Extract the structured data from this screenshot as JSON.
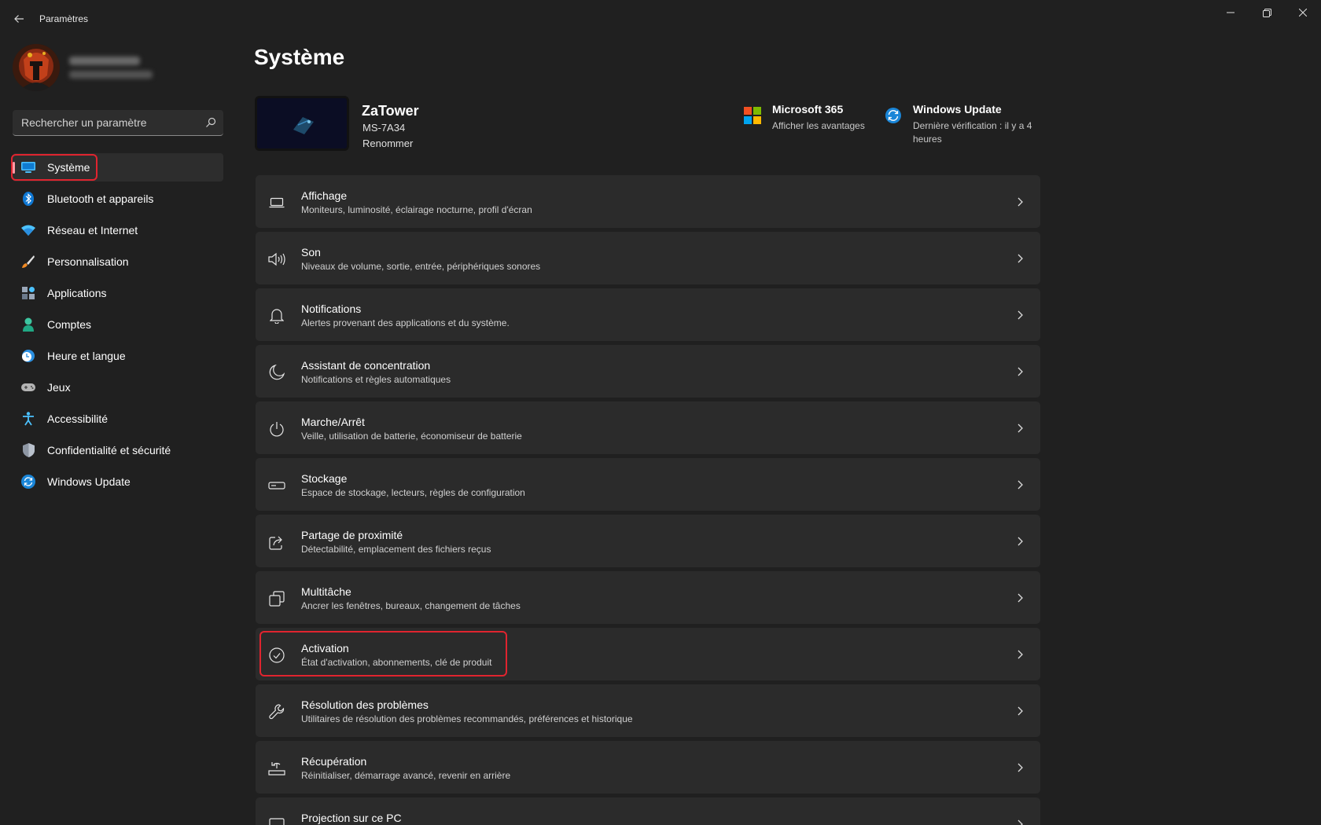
{
  "window": {
    "title": "Paramètres"
  },
  "sidebar": {
    "search_placeholder": "Rechercher un paramètre",
    "items": [
      {
        "label": "Système",
        "icon": "monitor-icon",
        "active": true
      },
      {
        "label": "Bluetooth et appareils",
        "icon": "bluetooth-icon"
      },
      {
        "label": "Réseau et Internet",
        "icon": "wifi-icon"
      },
      {
        "label": "Personnalisation",
        "icon": "brush-icon"
      },
      {
        "label": "Applications",
        "icon": "apps-icon"
      },
      {
        "label": "Comptes",
        "icon": "person-icon"
      },
      {
        "label": "Heure et langue",
        "icon": "clock-globe-icon"
      },
      {
        "label": "Jeux",
        "icon": "gamepad-icon"
      },
      {
        "label": "Accessibilité",
        "icon": "accessibility-icon"
      },
      {
        "label": "Confidentialité et sécurité",
        "icon": "shield-icon"
      },
      {
        "label": "Windows Update",
        "icon": "sync-icon"
      }
    ]
  },
  "main": {
    "title": "Système",
    "device": {
      "name": "ZaTower",
      "model": "MS-7A34",
      "rename": "Renommer"
    },
    "quick_links": [
      {
        "title": "Microsoft 365",
        "subtitle": "Afficher les avantages",
        "icon": "microsoft-logo-icon"
      },
      {
        "title": "Windows Update",
        "subtitle": "Dernière vérification : il y a 4 heures",
        "icon": "windows-update-icon"
      }
    ],
    "settings": [
      {
        "title": "Affichage",
        "subtitle": "Moniteurs, luminosité, éclairage nocturne, profil d'écran",
        "icon": "display-icon"
      },
      {
        "title": "Son",
        "subtitle": "Niveaux de volume, sortie, entrée, périphériques sonores",
        "icon": "speaker-icon"
      },
      {
        "title": "Notifications",
        "subtitle": "Alertes provenant des applications et du système.",
        "icon": "bell-icon"
      },
      {
        "title": "Assistant de concentration",
        "subtitle": "Notifications et règles automatiques",
        "icon": "moon-icon"
      },
      {
        "title": "Marche/Arrêt",
        "subtitle": "Veille, utilisation de batterie, économiseur de batterie",
        "icon": "power-icon"
      },
      {
        "title": "Stockage",
        "subtitle": "Espace de stockage, lecteurs, règles de configuration",
        "icon": "storage-icon"
      },
      {
        "title": "Partage de proximité",
        "subtitle": "Détectabilité, emplacement des fichiers reçus",
        "icon": "share-icon"
      },
      {
        "title": "Multitâche",
        "subtitle": "Ancrer les fenêtres, bureaux, changement de tâches",
        "icon": "multitask-icon"
      },
      {
        "title": "Activation",
        "subtitle": "État d'activation, abonnements, clé de produit",
        "icon": "check-circle-icon"
      },
      {
        "title": "Résolution des problèmes",
        "subtitle": "Utilitaires de résolution des problèmes recommandés, préférences et historique",
        "icon": "wrench-icon"
      },
      {
        "title": "Récupération",
        "subtitle": "Réinitialiser, démarrage avancé, revenir en arrière",
        "icon": "recovery-icon"
      },
      {
        "title": "Projection sur ce PC",
        "subtitle": "",
        "icon": "projection-icon"
      }
    ]
  },
  "colors": {
    "background": "#202020",
    "card": "#2b2b2b",
    "highlight_border": "#e0242f",
    "active_indicator": "#ff99a4",
    "accent_blue": "#4cc2ff"
  }
}
